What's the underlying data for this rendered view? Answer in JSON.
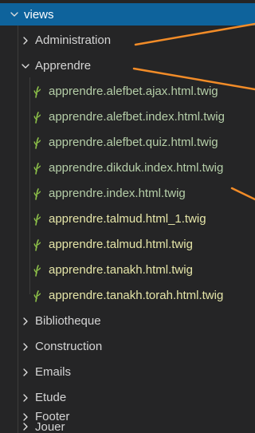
{
  "explorer": {
    "root": {
      "label": "views",
      "expanded": true
    },
    "items": [
      {
        "label": "Administration",
        "type": "folder",
        "expanded": false
      },
      {
        "label": "Apprendre",
        "type": "folder",
        "expanded": true
      },
      {
        "label": "apprendre.alefbet.ajax.html.twig",
        "type": "file",
        "git": "modified"
      },
      {
        "label": "apprendre.alefbet.index.html.twig",
        "type": "file",
        "git": "modified"
      },
      {
        "label": "apprendre.alefbet.quiz.html.twig",
        "type": "file",
        "git": "modified"
      },
      {
        "label": "apprendre.dikduk.index.html.twig",
        "type": "file",
        "git": "modified"
      },
      {
        "label": "apprendre.index.html.twig",
        "type": "file",
        "git": "modified"
      },
      {
        "label": "apprendre.talmud.html_1.twig",
        "type": "file",
        "git": "none"
      },
      {
        "label": "apprendre.talmud.html.twig",
        "type": "file",
        "git": "none"
      },
      {
        "label": "apprendre.tanakh.html.twig",
        "type": "file",
        "git": "none"
      },
      {
        "label": "apprendre.tanakh.torah.html.twig",
        "type": "file",
        "git": "none"
      },
      {
        "label": "Bibliotheque",
        "type": "folder",
        "expanded": false
      },
      {
        "label": "Construction",
        "type": "folder",
        "expanded": false
      },
      {
        "label": "Emails",
        "type": "folder",
        "expanded": false
      },
      {
        "label": "Etude",
        "type": "folder",
        "expanded": false
      },
      {
        "label": "Footer",
        "type": "folder",
        "expanded": false
      },
      {
        "label": "Jouer",
        "type": "folder",
        "expanded": false
      }
    ]
  },
  "colors": {
    "background": "#252526",
    "selection": "#0e639c",
    "folder_text": "#d4d4d4",
    "file_text_modified": "#e5e5a8",
    "file_text": "#d4d4d4",
    "twig_icon": "#8dc149",
    "annotation_line": "#f28c28"
  }
}
